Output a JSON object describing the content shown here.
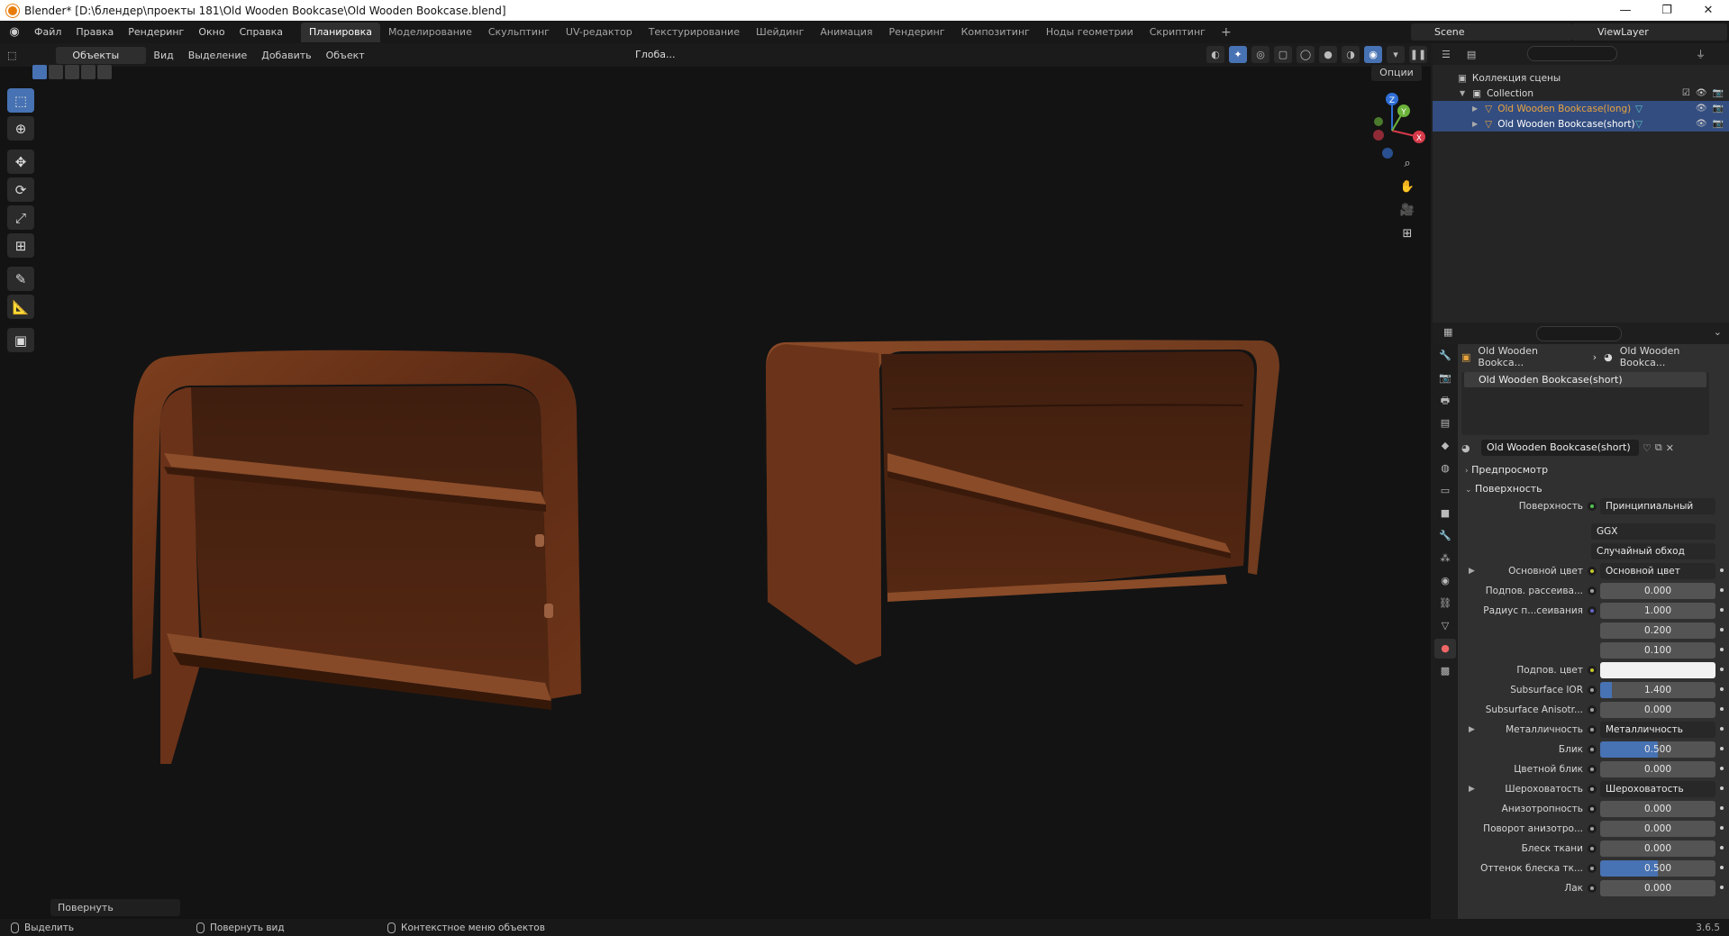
{
  "window": {
    "title": "Blender* [D:\\блендер\\проекты 181\\Old Wooden Bookcase\\Old Wooden Bookcase.blend]",
    "controls": [
      "—",
      "❐",
      "✕"
    ]
  },
  "menu": [
    "Файл",
    "Правка",
    "Рендеринг",
    "Окно",
    "Справка"
  ],
  "workspaces": [
    "Планировка",
    "Моделирование",
    "Скульптинг",
    "UV-редактор",
    "Текстурирование",
    "Шейдинг",
    "Анимация",
    "Рендеринг",
    "Композитинг",
    "Ноды геометрии",
    "Скриптинг"
  ],
  "workspace_add": "+",
  "scene_name": "Scene",
  "view_layer": "ViewLayer",
  "viewport": {
    "mode": "Объекты",
    "menus": [
      "Вид",
      "Выделение",
      "Добавить",
      "Объект"
    ],
    "transform_orientation": "Глоба...",
    "options_label": "Опции",
    "redo_panel": "Повернуть",
    "gizmo_axes": [
      "X",
      "Y",
      "Z"
    ]
  },
  "outliner": {
    "root": "Коллекция сцены",
    "collection": "Collection",
    "objects": [
      {
        "name": "Old Wooden Bookcase(long)",
        "color": "#e8a33d"
      },
      {
        "name": "Old Wooden Bookcase(short)",
        "color": "#ffffff"
      }
    ]
  },
  "properties": {
    "breadcrumb_object": "Old Wooden Bookca...",
    "breadcrumb_material": "Old Wooden Bookca...",
    "material_slot": "Old Wooden Bookcase(short)",
    "material_name": "Old Wooden Bookcase(short)",
    "panel_preview": "Предпросмотр",
    "panel_surface": "Поверхность",
    "surface_label": "Поверхность",
    "surface_shader": "Принципиальный BSDF",
    "distribution": "GGX",
    "subsurface_method": "Случайный обход",
    "rows": [
      {
        "label": "Основной цвет",
        "kind": "link",
        "value": "Основной цвет",
        "expand": true,
        "socket": "#c7c729"
      },
      {
        "label": "Подпов. рассеива...",
        "kind": "number",
        "value": "0.000",
        "socket": "#a1a1a1"
      },
      {
        "label": "Радиус п...сеивания",
        "kind": "number",
        "value": "1.000",
        "socket": "#6363c7"
      },
      {
        "label": "",
        "kind": "number",
        "value": "0.200"
      },
      {
        "label": "",
        "kind": "number",
        "value": "0.100"
      },
      {
        "label": "Подпов. цвет",
        "kind": "color",
        "value": "",
        "socket": "#c7c729"
      },
      {
        "label": "Subsurface IOR",
        "kind": "number",
        "value": "1.400",
        "fill": 0.1,
        "socket": "#a1a1a1"
      },
      {
        "label": "Subsurface Anisotr...",
        "kind": "number",
        "value": "0.000",
        "socket": "#a1a1a1"
      },
      {
        "label": "Металличность",
        "kind": "link",
        "value": "Металличность",
        "expand": true,
        "socket": "#a1a1a1"
      },
      {
        "label": "Блик",
        "kind": "number",
        "value": "0.500",
        "fill": 0.5,
        "socket": "#a1a1a1"
      },
      {
        "label": "Цветной блик",
        "kind": "number",
        "value": "0.000",
        "socket": "#a1a1a1"
      },
      {
        "label": "Шероховатость",
        "kind": "link",
        "value": "Шероховатость",
        "expand": true,
        "socket": "#a1a1a1"
      },
      {
        "label": "Анизотропность",
        "kind": "number",
        "value": "0.000",
        "socket": "#a1a1a1"
      },
      {
        "label": "Поворот анизотро...",
        "kind": "number",
        "value": "0.000",
        "socket": "#a1a1a1"
      },
      {
        "label": "Блеск ткани",
        "kind": "number",
        "value": "0.000",
        "socket": "#a1a1a1"
      },
      {
        "label": "Оттенок блеска тк...",
        "kind": "number",
        "value": "0.500",
        "fill": 0.5,
        "socket": "#a1a1a1"
      },
      {
        "label": "Лак",
        "kind": "number",
        "value": "0.000",
        "socket": "#a1a1a1"
      }
    ]
  },
  "statusbar": {
    "select": "Выделить",
    "rotate_view": "Повернуть вид",
    "context_menu": "Контекстное меню объектов",
    "version": "3.6.5"
  },
  "colors": {
    "accent": "#4772b3",
    "selection": "#334d80",
    "active_object": "#e8a33d",
    "wood_dark": "#4a2414",
    "wood_light": "#8a4a27"
  }
}
